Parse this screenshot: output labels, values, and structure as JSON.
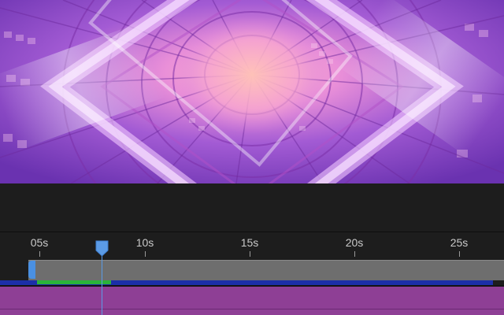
{
  "preview": {
    "colors": {
      "background": "#7a3fb5",
      "glow": "#ffb3d0",
      "accent": "#e8a8ff"
    }
  },
  "timeline": {
    "ticks": [
      {
        "label": "05s",
        "seconds": 5
      },
      {
        "label": "10s",
        "seconds": 10
      },
      {
        "label": "15s",
        "seconds": 15
      },
      {
        "label": "20s",
        "seconds": 20
      },
      {
        "label": "25s",
        "seconds": 25
      }
    ],
    "playhead_seconds": 7.9,
    "colors": {
      "playhead": "#5b9be6",
      "layer_bar": "#8e3f95",
      "range_bar": "#1c2fa8",
      "preview_range": "#2bb33a"
    }
  }
}
